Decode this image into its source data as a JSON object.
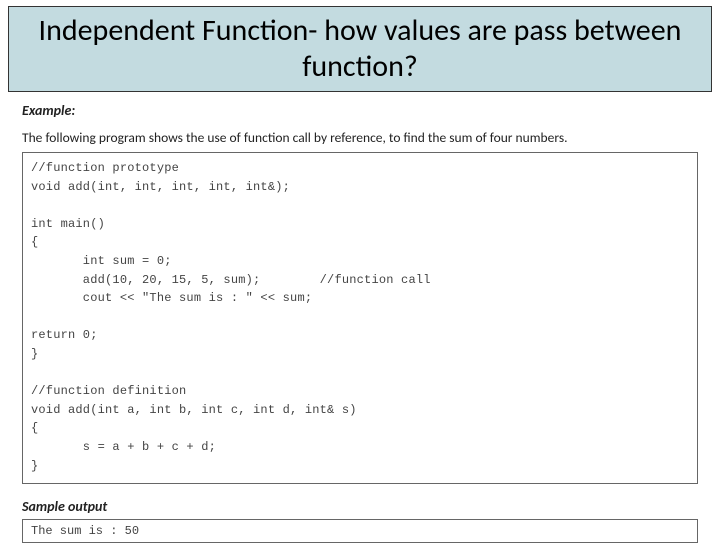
{
  "title": "Independent Function- how values are pass between function?",
  "example_label": "Example:",
  "description": "The following program shows the use of function call by reference, to find the sum of four numbers.",
  "code": "//function prototype\nvoid add(int, int, int, int, int&);\n\nint main()\n{\n       int sum = 0;\n       add(10, 20, 15, 5, sum);        //function call\n       cout << \"The sum is : \" << sum;\n\nreturn 0;\n}\n\n//function definition\nvoid add(int a, int b, int c, int d, int& s)\n{\n       s = a + b + c + d;\n}",
  "sample_output_label": "Sample output",
  "sample_output": "The sum is : 50"
}
